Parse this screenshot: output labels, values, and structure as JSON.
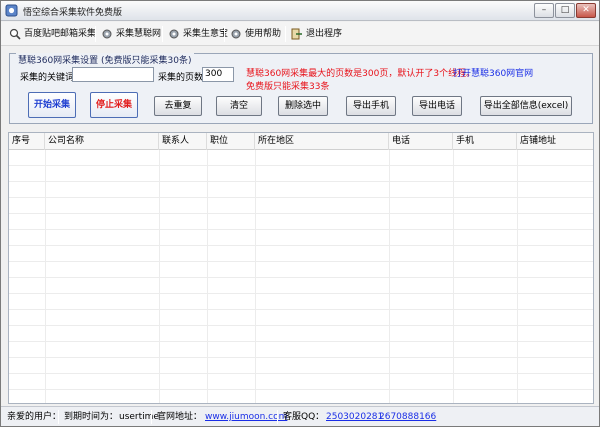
{
  "window": {
    "title": "悟空综合采集软件免费版"
  },
  "menu": [
    {
      "label": "百度贴吧邮箱采集",
      "icon": "magnifier-icon"
    },
    {
      "label": "采集慧聪网",
      "icon": "gear-icon"
    },
    {
      "label": "采集生意宝",
      "icon": "gear-icon"
    },
    {
      "label": "使用帮助",
      "icon": "gear-icon"
    },
    {
      "label": "退出程序",
      "icon": "exit-icon"
    }
  ],
  "settings": {
    "group_title": "慧聪360网采集设置 (免费版只能采集30条)",
    "keyword_label": "采集的关键词",
    "keyword_value": "",
    "pages_label": "采集的页数",
    "pages_value": "300",
    "notice_line1": "慧聪360网采集最大的页数是300页，默认开了3个线程。",
    "notice_line2": "免费版只能采集33条",
    "open_site_link": "打开慧聪360网官网"
  },
  "buttons": {
    "start": "开始采集",
    "stop": "停止采集",
    "dedupe": "去重复",
    "clear": "清空",
    "delete_selected": "删除选中",
    "export_phone": "导出手机",
    "export_tel": "导出电话",
    "export_all": "导出全部信息(excel)"
  },
  "table": {
    "columns": [
      "序号",
      "公司名称",
      "联系人",
      "职位",
      "所在地区",
      "电话",
      "手机",
      "店铺地址"
    ],
    "rows": []
  },
  "status": {
    "user_label": "亲爱的用户：",
    "expire_label": "到期时间为：",
    "expire_value": "usertime",
    "site_label": "官网地址：",
    "site_value": "www.jiumoon.com",
    "qq_label": "客服QQ：",
    "qq1": "2503020281",
    "qq2": "2670888166"
  },
  "colors": {
    "accent_blue": "#1a2ee6",
    "warning_red": "#e8131b"
  }
}
